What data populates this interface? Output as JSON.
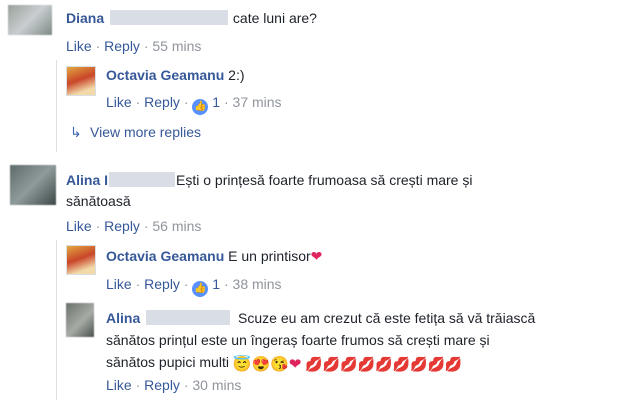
{
  "c1": {
    "name": "Diana",
    "text": "cate luni are?",
    "like": "Like",
    "reply": "Reply",
    "time": "55 mins"
  },
  "r1": {
    "name": "Octavia Geamanu",
    "text": "2:)",
    "like": "Like",
    "reply": "Reply",
    "likes": "1",
    "time": "37 mins"
  },
  "view_more": "View more replies",
  "c2": {
    "name": "Alina I",
    "text_line1": "Ești o prințesă foarte frumoasa să crești mare și",
    "text_line2": "sănătoasă",
    "like": "Like",
    "reply": "Reply",
    "time": "56 mins"
  },
  "r2": {
    "name": "Octavia Geamanu",
    "text": "E un printisor",
    "like": "Like",
    "reply": "Reply",
    "likes": "1",
    "time": "38 mins"
  },
  "r3": {
    "name": "Alina",
    "text_line1": "Scuze eu am crezut că este fetița să vă trăiască",
    "text_line2": "sănătos prințul este un îngeraș foarte frumos să crești mare și",
    "text_line3": "sănătos pupici multi",
    "like": "Like",
    "reply": "Reply",
    "time": "30 mins"
  },
  "separator": "·",
  "icons": {
    "reply_arrow": "reply-arrow-icon",
    "like_badge": "like-thumb-icon",
    "heart": "red-heart-icon",
    "kiss": "kiss-mark-icon"
  },
  "colors": {
    "link": "#365899",
    "meta": "#90949c",
    "like_badge": "#5890ff"
  }
}
